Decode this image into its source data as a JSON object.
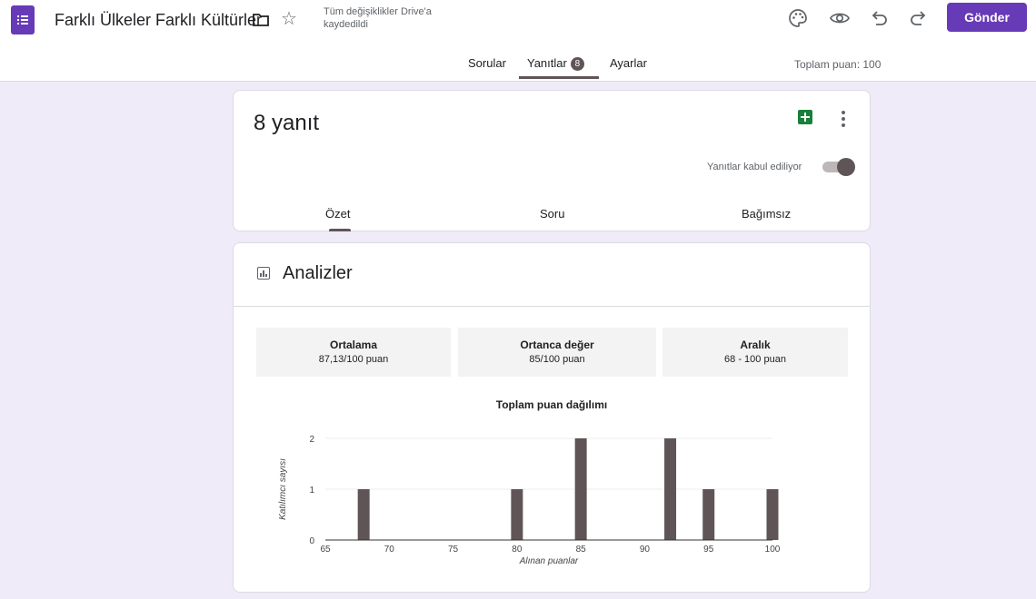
{
  "header": {
    "doc_title": "Farklı Ülkeler Farklı Kültürler",
    "save_status": "Tüm değişiklikler Drive'a kaydedildi",
    "send_label": "Gönder",
    "tabs": {
      "questions": "Sorular",
      "responses": "Yanıtlar",
      "responses_count": "8",
      "settings": "Ayarlar"
    },
    "total_points": "Toplam puan: 100"
  },
  "responses_card": {
    "count_label": "8 yanıt",
    "accepting_label": "Yanıtlar kabul ediliyor",
    "accepting": true,
    "subtabs": [
      "Özet",
      "Soru",
      "Bağımsız"
    ]
  },
  "analytics": {
    "title": "Analizler",
    "stats": [
      {
        "label": "Ortalama",
        "value": "87,13/100 puan"
      },
      {
        "label": "Ortanca değer",
        "value": "85/100 puan"
      },
      {
        "label": "Aralık",
        "value": "68 - 100 puan"
      }
    ]
  },
  "colors": {
    "brand": "#673ab7",
    "bar": "#5f5557",
    "background": "#f0ebf8"
  },
  "chart_data": {
    "type": "bar",
    "title": "Toplam puan dağılımı",
    "xlabel": "Alınan puanlar",
    "ylabel": "Katılımcı sayısı",
    "x": [
      68,
      80,
      85,
      92,
      95,
      100
    ],
    "values": [
      1,
      1,
      2,
      2,
      1,
      1
    ],
    "xlim": [
      65,
      100
    ],
    "ylim": [
      0,
      2
    ],
    "xticks": [
      65,
      70,
      75,
      80,
      85,
      90,
      95,
      100
    ],
    "yticks": [
      0,
      1,
      2
    ],
    "grid": true
  }
}
